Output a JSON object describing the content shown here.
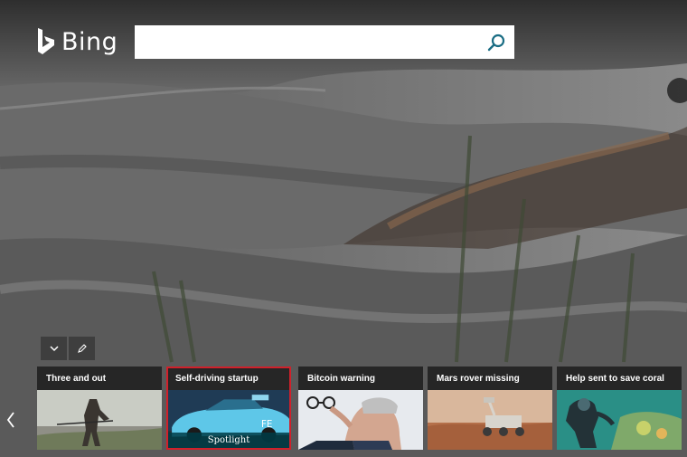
{
  "brand": {
    "name": "Bing",
    "logo_icon": "bing-b-logo-icon"
  },
  "search": {
    "value": "",
    "placeholder": "",
    "button_icon": "search-icon"
  },
  "controls": {
    "collapse_icon": "chevron-down-icon",
    "edit_icon": "pencil-icon"
  },
  "carousel": {
    "prev_icon": "chevron-left-icon",
    "items": [
      {
        "title": "Three and out"
      },
      {
        "title": "Self-driving startup",
        "badge": "Spotlight",
        "selected": true
      },
      {
        "title": "Bitcoin warning"
      },
      {
        "title": "Mars rover missing"
      },
      {
        "title": "Help sent to save coral"
      }
    ]
  },
  "colors": {
    "selected_outline": "#d0202a",
    "search_icon": "#1a6d84"
  }
}
